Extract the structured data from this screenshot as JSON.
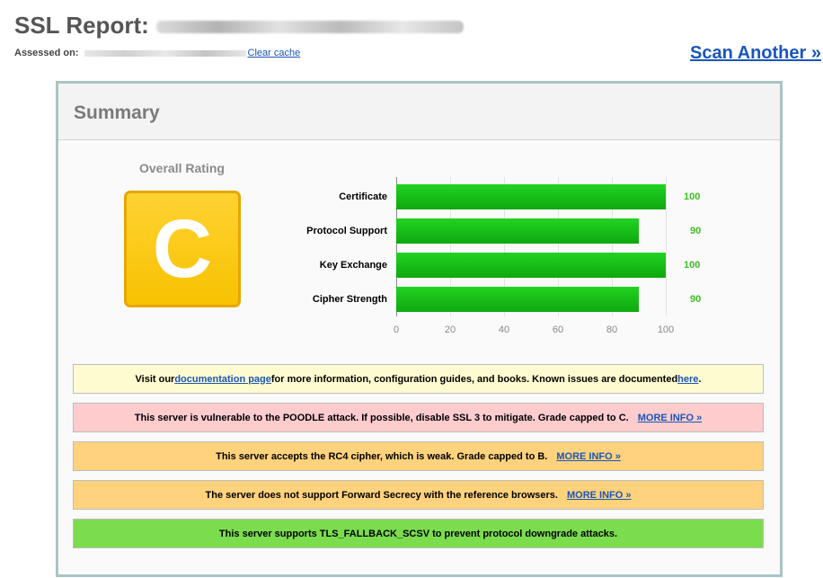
{
  "header": {
    "title": "SSL Report:",
    "assessed_label": "Assessed on:",
    "clear_cache": "Clear cache",
    "scan_another": "Scan Another »"
  },
  "summary": {
    "title": "Summary",
    "overall_label": "Overall Rating",
    "grade": "C",
    "grade_color": "#f7c200"
  },
  "chart_data": {
    "type": "bar",
    "categories": [
      "Certificate",
      "Protocol Support",
      "Key Exchange",
      "Cipher Strength"
    ],
    "values": [
      100,
      90,
      100,
      90
    ],
    "value_labels": [
      "100",
      "90",
      "100",
      "90"
    ],
    "xlim": [
      0,
      100
    ],
    "ticks": [
      "0",
      "20",
      "40",
      "60",
      "80",
      "100"
    ],
    "bar_color": "#0ea80e"
  },
  "messages": [
    {
      "type": "info",
      "parts": [
        "Visit our ",
        "documentation page",
        " for more information, configuration guides, and books. Known issues are documented ",
        "here",
        "."
      ]
    },
    {
      "type": "danger",
      "text": "This server is vulnerable to the POODLE attack. If possible, disable SSL 3 to mitigate. Grade capped to C.",
      "link": "MORE INFO »"
    },
    {
      "type": "warn",
      "text": "This server accepts the RC4 cipher, which is weak. Grade capped to B.",
      "link": "MORE INFO »"
    },
    {
      "type": "warn",
      "text": "The server does not support Forward Secrecy with the reference browsers.",
      "link": "MORE INFO »"
    },
    {
      "type": "good",
      "text": "This server supports TLS_FALLBACK_SCSV to prevent protocol downgrade attacks."
    }
  ]
}
